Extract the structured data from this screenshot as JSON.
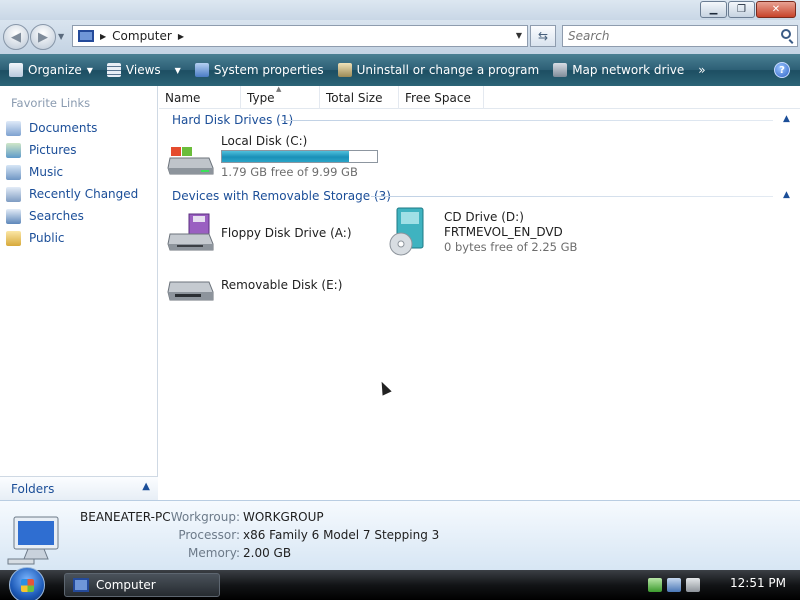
{
  "window": {
    "controls": [
      "minimize-icon",
      "maximize-icon",
      "close-icon"
    ]
  },
  "address": {
    "location_icon": "computer-icon",
    "path": "Computer",
    "search_placeholder": "Search"
  },
  "commands": [
    {
      "label": "Organize",
      "icon": "organize-icon",
      "dropdown": true
    },
    {
      "label": "Views",
      "icon": "views-icon",
      "dropdown": true
    },
    {
      "label": "System properties",
      "icon": "system-properties-icon"
    },
    {
      "label": "Uninstall or change a program",
      "icon": "uninstall-icon"
    },
    {
      "label": "Map network drive",
      "icon": "network-drive-icon"
    }
  ],
  "more_commands": "»",
  "favorites": {
    "heading": "Favorite Links",
    "items": [
      {
        "label": "Documents",
        "icon": "documents-icon"
      },
      {
        "label": "Pictures",
        "icon": "pictures-icon"
      },
      {
        "label": "Music",
        "icon": "music-icon"
      },
      {
        "label": "Recently Changed",
        "icon": "recently-changed-icon"
      },
      {
        "label": "Searches",
        "icon": "searches-icon"
      },
      {
        "label": "Public",
        "icon": "public-folder-icon"
      }
    ]
  },
  "folders_label": "Folders",
  "columns": [
    "Name",
    "Type",
    "Total Size",
    "Free Space"
  ],
  "groups": {
    "hard_disk": {
      "label": "Hard Disk Drives (1)",
      "drives": [
        {
          "name": "Local Disk (C:)",
          "free": "1.79 GB free of 9.99 GB",
          "used_fraction": 0.82,
          "icon": "hard-disk-icon"
        }
      ]
    },
    "removable": {
      "label": "Devices with Removable Storage (3)",
      "drives": [
        {
          "name": "Floppy Disk Drive (A:)",
          "icon": "floppy-drive-icon"
        },
        {
          "name": "CD Drive (D:)",
          "label": "FRTMEVOL_EN_DVD",
          "free": "0 bytes free of 2.25 GB",
          "icon": "cd-drive-icon"
        },
        {
          "name": "Removable Disk (E:)",
          "icon": "removable-disk-icon"
        }
      ]
    }
  },
  "details": {
    "name": "BEANEATER-PC",
    "workgroup_label": "Workgroup:",
    "workgroup": "WORKGROUP",
    "processor_label": "Processor:",
    "processor": "x86 Family 6 Model 7 Stepping 3",
    "memory_label": "Memory:",
    "memory": "2.00 GB"
  },
  "taskbar": {
    "task_label": "Computer",
    "clock": "12:51 PM"
  },
  "colors": {
    "command_bar": "#2c5f75",
    "link": "#1b4e98",
    "progress": "#1a90b8"
  }
}
